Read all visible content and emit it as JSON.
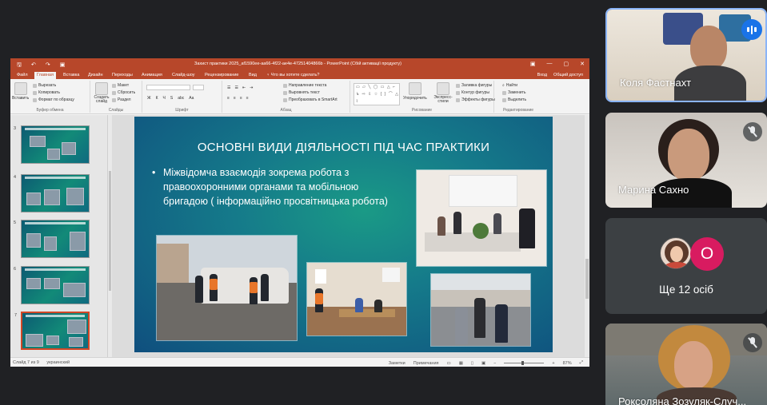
{
  "powerpoint": {
    "window_title": "Захист практики 2025_af1590ee-aa66-4f22-ae4e-47251404866b - PowerPoint (Сбій активації продукту)",
    "tabs": [
      "Файл",
      "Главная",
      "Вставка",
      "Дизайн",
      "Переходы",
      "Анимация",
      "Слайд-шоу",
      "Рецензирование",
      "Вид"
    ],
    "active_tab": "Главная",
    "tell_me": "♀ Что вы хотите сделать?",
    "sign_in": "Вход",
    "share": "Общий доступ",
    "ribbon": {
      "clipboard": {
        "paste": "Вставить",
        "cut": "Вырезать",
        "copy": "Копировать",
        "format_painter": "Формат по образцу",
        "label": "Буфер обмена"
      },
      "slides": {
        "new_slide": "Создать слайд",
        "layout": "Макет",
        "reset": "Сбросить",
        "section": "Раздел",
        "label": "Слайды"
      },
      "font": {
        "bold": "Ж",
        "italic": "К",
        "underline": "Ч",
        "strike": "S",
        "spacing": "abc",
        "case": "Aa",
        "label": "Шрифт"
      },
      "paragraph": {
        "direction": "Направление текста",
        "align": "Выровнять текст",
        "smartart": "Преобразовать в SmartArt",
        "label": "Абзац"
      },
      "drawing": {
        "shapes_preview": "▭ ▱ ╲ ◯ ▭ △ ⌐ ↳ ⇨ ⇩ ☆ { } ⌒ △ ⌇",
        "arrange": "Упорядочить",
        "quick_styles": "Экспресс-стили",
        "fill": "Заливка фигуры",
        "outline": "Контур фигуры",
        "effects": "Эффекты фигуры",
        "label": "Рисование"
      },
      "editing": {
        "find": "Найти",
        "replace": "Заменить",
        "select": "Выделить",
        "label": "Редактирование"
      }
    },
    "thumbnails": [
      {
        "number": "3",
        "title": "ОСНОВНІ ВИДИ ДІЯЛЬНОСТІ ПІД ЧАС ПРАКТИКИ"
      },
      {
        "number": "4",
        "title": "ОСНОВНІ ВИДИ ДІЯЛЬНОСТІ ПІД ЧАС ПРАКТИКИ"
      },
      {
        "number": "5",
        "title": "ОСНОВНІ ВИДИ ДІЯЛЬНОСТІ ПІД ЧАС ПРАКТИКИ"
      },
      {
        "number": "6",
        "title": "ОСНОВНІ ВИДИ ДІЯЛЬНОСТІ ПІД ЧАС ПРАКТИКИ"
      },
      {
        "number": "7",
        "title": "ОСНОВНІ ВИДИ ДІЯЛЬНОСТІ ПІД ЧАС ПРАКТИКИ"
      }
    ],
    "slide": {
      "title": "ОСНОВНІ ВИДИ ДІЯЛЬНОСТІ ПІД ЧАС ПРАКТИКИ",
      "bullet": "Міжвідомча взаємодія зокрема робота з правоохоронними органами та мобільною бригадою ( інформаційно просвітницька робота)"
    },
    "status": {
      "slide_counter": "Слайд 7 из 9",
      "language": "украинский",
      "notes": "Заметки",
      "comments": "Примечания",
      "zoom": "87%"
    }
  },
  "participants": [
    {
      "name": "Коля Фастнахт",
      "speaking": true
    },
    {
      "name": "Марина Сахно",
      "muted": true
    },
    {
      "name": "Роксоляна Зозуляк-Случ...",
      "muted": true
    }
  ],
  "more_participants": {
    "label": "Ще 12 осіб",
    "avatar_letter": "О",
    "avatar_letter_color": "#d81b60"
  },
  "colors": {
    "ppt_accent": "#b7472a",
    "meet_bg": "#202124",
    "speaking_blue": "#1a73e8"
  }
}
